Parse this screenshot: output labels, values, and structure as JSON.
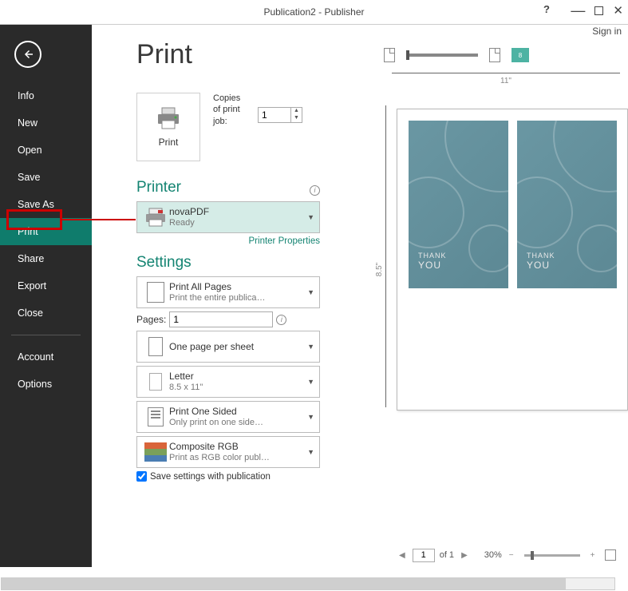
{
  "window": {
    "title": "Publication2 - Publisher",
    "signin": "Sign in"
  },
  "sidebar": {
    "items": [
      "Info",
      "New",
      "Open",
      "Save",
      "Save As",
      "Print",
      "Share",
      "Export",
      "Close"
    ],
    "items2": [
      "Account",
      "Options"
    ],
    "active": "Print"
  },
  "page": {
    "title": "Print"
  },
  "printBtn": {
    "label": "Print"
  },
  "copies": {
    "label": "Copies of print job:",
    "value": "1"
  },
  "printer": {
    "heading": "Printer",
    "name": "novaPDF",
    "status": "Ready",
    "propsLink": "Printer Properties"
  },
  "settings": {
    "heading": "Settings",
    "printAll": {
      "l1": "Print All Pages",
      "l2": "Print the entire publica…"
    },
    "pagesLabel": "Pages:",
    "pagesValue": "1",
    "layout": {
      "l1": "One page per sheet"
    },
    "paper": {
      "l1": "Letter",
      "l2": "8.5 x 11\""
    },
    "sided": {
      "l1": "Print One Sided",
      "l2": "Only print on one side…"
    },
    "color": {
      "l1": "Composite RGB",
      "l2": "Print as RGB color publ…"
    },
    "saveChk": "Save settings with publication"
  },
  "preview": {
    "widthLabel": "11\"",
    "heightLabel": "8.5\"",
    "tealBadge": "8",
    "pageCurrent": "1",
    "pageOf": "of 1",
    "zoom": "30%",
    "card": {
      "line1": "THANK",
      "line2": "YOU"
    }
  }
}
